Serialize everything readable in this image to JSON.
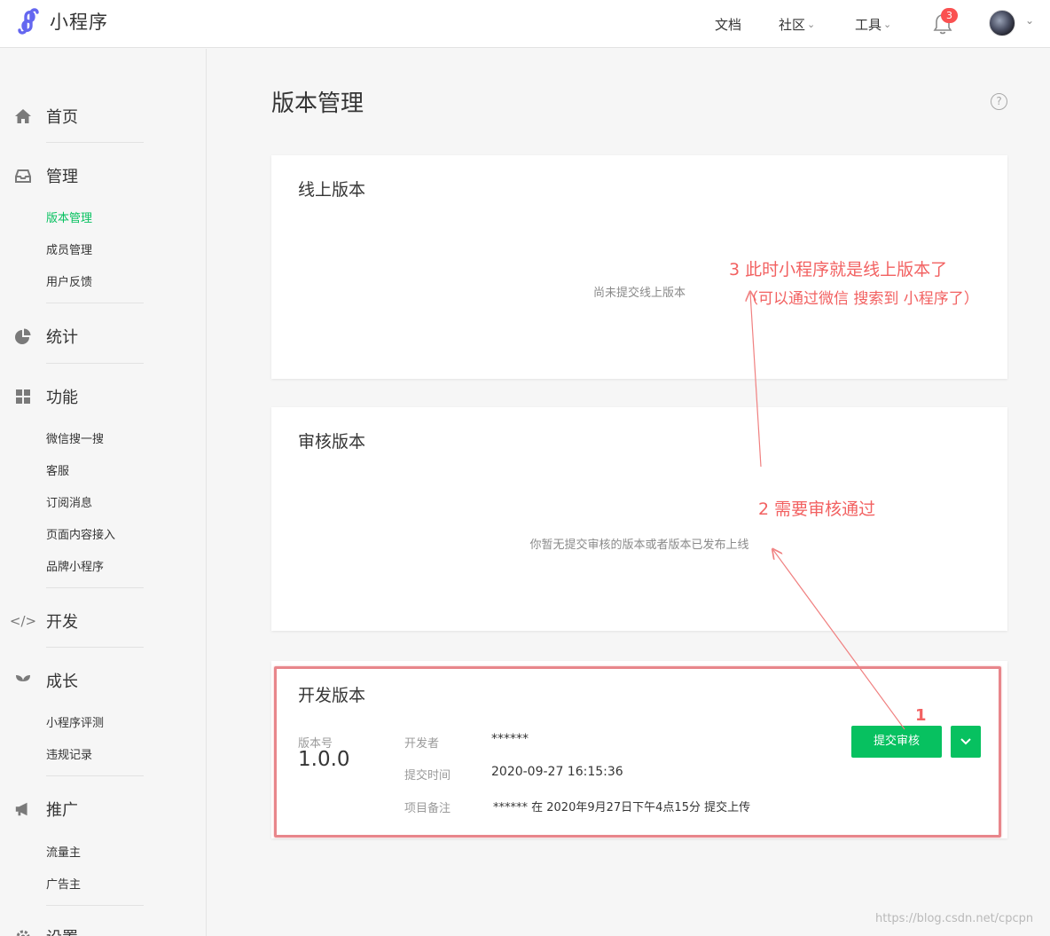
{
  "brand": {
    "name": "小程序"
  },
  "topnav": {
    "docs": "文档",
    "community": "社区",
    "tools": "工具",
    "notification_count": "3"
  },
  "sidebar": {
    "home": "首页",
    "manage": "管理",
    "manage_items": [
      "版本管理",
      "成员管理",
      "用户反馈"
    ],
    "stats": "统计",
    "features": "功能",
    "feature_items": [
      "微信搜一搜",
      "客服",
      "订阅消息",
      "页面内容接入",
      "品牌小程序"
    ],
    "develop": "开发",
    "growth": "成长",
    "growth_items": [
      "小程序评测",
      "违规记录"
    ],
    "promote": "推广",
    "promote_items": [
      "流量主",
      "广告主"
    ],
    "settings": "设置"
  },
  "page": {
    "title": "版本管理",
    "help": "?"
  },
  "online": {
    "title": "线上版本",
    "empty": "尚未提交线上版本"
  },
  "review": {
    "title": "审核版本",
    "empty": "你暂无提交审核的版本或者版本已发布上线"
  },
  "dev": {
    "title": "开发版本",
    "version_label": "版本号",
    "version": "1.0.0",
    "developer_label": "开发者",
    "developer": "******",
    "time_label": "提交时间",
    "time": "2020-09-27 16:15:36",
    "note_label": "项目备注",
    "note": "****** 在 2020年9月27日下午4点15分 提交上传",
    "submit_button": "提交审核"
  },
  "annotations": {
    "step1": "1",
    "step2": "2 需要审核通过",
    "step3": "3 此时小程序就是线上版本了",
    "step3_note": "（可以通过微信 搜索到 小程序了）",
    "color": "#f26161"
  },
  "watermark": "https://blog.csdn.net/cpcpn"
}
